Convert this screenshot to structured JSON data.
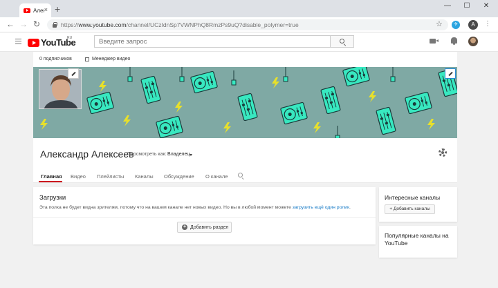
{
  "browser": {
    "tab_title": "Алек",
    "tab_close": "×",
    "new_tab": "+",
    "url_prefix": "https://",
    "url_host": "www.youtube.com",
    "url_path": "/channel/UCzIdnSp7VWNPhQ8RmzPs9uQ?disable_polymer=true",
    "profile_letter": "A",
    "extension_label": "✈"
  },
  "masthead": {
    "logo_text": "YouTube",
    "logo_region": "RU",
    "search_placeholder": "Введите запрос"
  },
  "channel_bar": {
    "subscribers": "0 подписчиков",
    "video_manager": "Менеджер видео"
  },
  "channel": {
    "name": "Александр Алексеев",
    "view_as_label": "Просмотреть как:",
    "view_as_value": "Владелец"
  },
  "tabs": [
    {
      "label": "Главная"
    },
    {
      "label": "Видео"
    },
    {
      "label": "Плейлисты"
    },
    {
      "label": "Каналы"
    },
    {
      "label": "Обсуждение"
    },
    {
      "label": "О канале"
    }
  ],
  "uploads": {
    "title": "Загрузки",
    "text": "Эта полка не будет видна зрителям, потому что на вашем канале нет новых видео. Но вы в любой момент можете ",
    "link": "загрузить ещё один ролик",
    "text_end": ".",
    "add_section_label": "Добавить раздел"
  },
  "sidebar": {
    "interesting_title": "Интересные каналы",
    "add_channels_label": "+ Добавить каналы",
    "popular_title": "Популярные каналы на YouTube"
  },
  "colors": {
    "banner_bg": "#7fa9a4",
    "accent_red": "#cc181e",
    "link_blue": "#167ac6",
    "turntable": "#38e8c0",
    "bolt": "#e8e02a"
  }
}
